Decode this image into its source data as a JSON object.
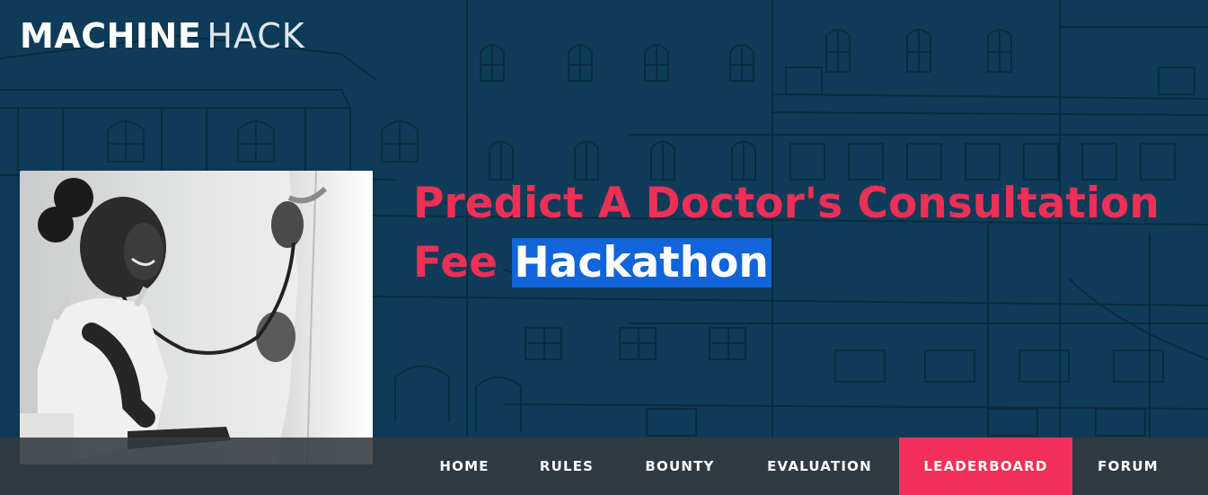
{
  "logo": {
    "bold": "MACHINE",
    "light": "HACK"
  },
  "hackathon": {
    "title_line1": "Predict A Doctor's Consultation",
    "title_line2_prefix": "Fee ",
    "title_line2_highlight": "Hackathon",
    "image": "doctor-with-stethoscope-examining-child"
  },
  "nav": {
    "home": "HOME",
    "rules": "RULES",
    "bounty": "BOUNTY",
    "evaluation": "EVALUATION",
    "leaderboard": "LEADERBOARD",
    "forum": "FORUM",
    "active": "leaderboard"
  },
  "colors": {
    "background": "#0e3c58",
    "title": "#ee2f56",
    "highlight": "#1164d9",
    "nav_bar": "#343a40",
    "nav_active": "#f2315a"
  }
}
